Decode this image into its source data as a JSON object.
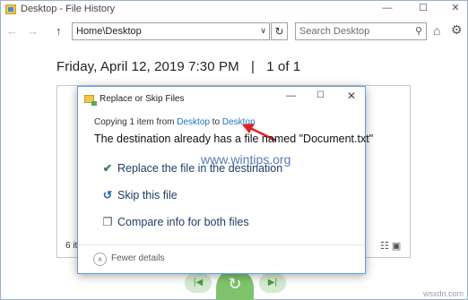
{
  "window": {
    "title": "Desktop - File History",
    "min_glyph": "—",
    "max_glyph": "☐",
    "close_glyph": "✕"
  },
  "nav": {
    "back_glyph": "←",
    "forward_glyph": "→",
    "up_glyph": "↑",
    "address": "Home\\Desktop",
    "address_dropdown_glyph": "∨",
    "refresh_glyph": "↻",
    "search_placeholder": "Search Desktop",
    "search_glyph": "⚲",
    "home_glyph": "⌂",
    "settings_glyph": "⚙"
  },
  "header": {
    "date": "Friday, April 12, 2019 7:30 PM",
    "separator": "|",
    "position": "1 of 1"
  },
  "content": {
    "items_count": "6 it",
    "view_glyphs": "☷ ▣"
  },
  "playback": {
    "previous_glyph": "|◀",
    "restore_glyph": "↻",
    "next_glyph": "▶|"
  },
  "dialog": {
    "title": "Replace or Skip Files",
    "min_glyph": "—",
    "max_glyph": "☐",
    "close_glyph": "✕",
    "copying_prefix": "Copying 1 item from ",
    "from_link": "Desktop",
    "to_word": " to ",
    "to_link": "Desktop",
    "message": "The destination already has a file named \"Document.txt\"",
    "options": [
      {
        "icon": "check-icon",
        "glyph": "✔",
        "label": "Replace the file in the destination"
      },
      {
        "icon": "skip-icon",
        "glyph": "↺",
        "label": "Skip this file"
      },
      {
        "icon": "compare-icon",
        "glyph": "❐",
        "label": "Compare info for both files"
      }
    ],
    "fewer_glyph": "∧",
    "fewer_details": "Fewer details"
  },
  "overlays": {
    "watermark": "www.wintips.org",
    "site_watermark": "wsxdn.com",
    "arrow_color": "#e02020"
  },
  "colors": {
    "link": "#1e73c8",
    "option_text": "#1d3f66",
    "restore_green": "#7fc46c"
  }
}
